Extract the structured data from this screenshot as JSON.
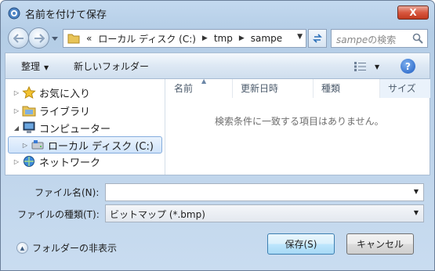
{
  "window": {
    "title": "名前を付けて保存",
    "close_label": "X"
  },
  "nav": {
    "address_prefix": "«",
    "breadcrumb": [
      "ローカル ディスク (C:)",
      "tmp",
      "sampe"
    ],
    "search_placeholder_italic": "sampe",
    "search_placeholder_suffix": "の検索"
  },
  "toolbar": {
    "organize_label": "整理",
    "new_folder_label": "新しいフォルダー",
    "help_label": "?"
  },
  "navigation_pane": {
    "items": [
      {
        "label": "お気に入り",
        "icon": "star-icon",
        "expander": "▷"
      },
      {
        "label": "ライブラリ",
        "icon": "library-icon",
        "expander": "▷"
      },
      {
        "label": "コンピューター",
        "icon": "computer-icon",
        "expander": "◢"
      },
      {
        "label": "ローカル ディスク (C:)",
        "icon": "drive-icon",
        "expander": "▷",
        "selected": true
      },
      {
        "label": "ネットワーク",
        "icon": "network-icon",
        "expander": "▷"
      }
    ]
  },
  "file_list": {
    "columns": [
      "名前",
      "更新日時",
      "種類",
      "サイズ"
    ],
    "empty_message": "検索条件に一致する項目はありません。"
  },
  "form": {
    "filename_label": "ファイル名(N):",
    "filename_value": "",
    "filetype_label": "ファイルの種類(T):",
    "filetype_value": "ビットマップ (*.bmp)"
  },
  "footer": {
    "hide_folders_label": "フォルダーの非表示",
    "save_label": "保存(S)",
    "cancel_label": "キャンセル"
  },
  "colors": {
    "frame": "#c3d9ef",
    "selection": "#cfe3fa",
    "help_button": "#1b5bc2",
    "close_button": "#d8583f"
  }
}
